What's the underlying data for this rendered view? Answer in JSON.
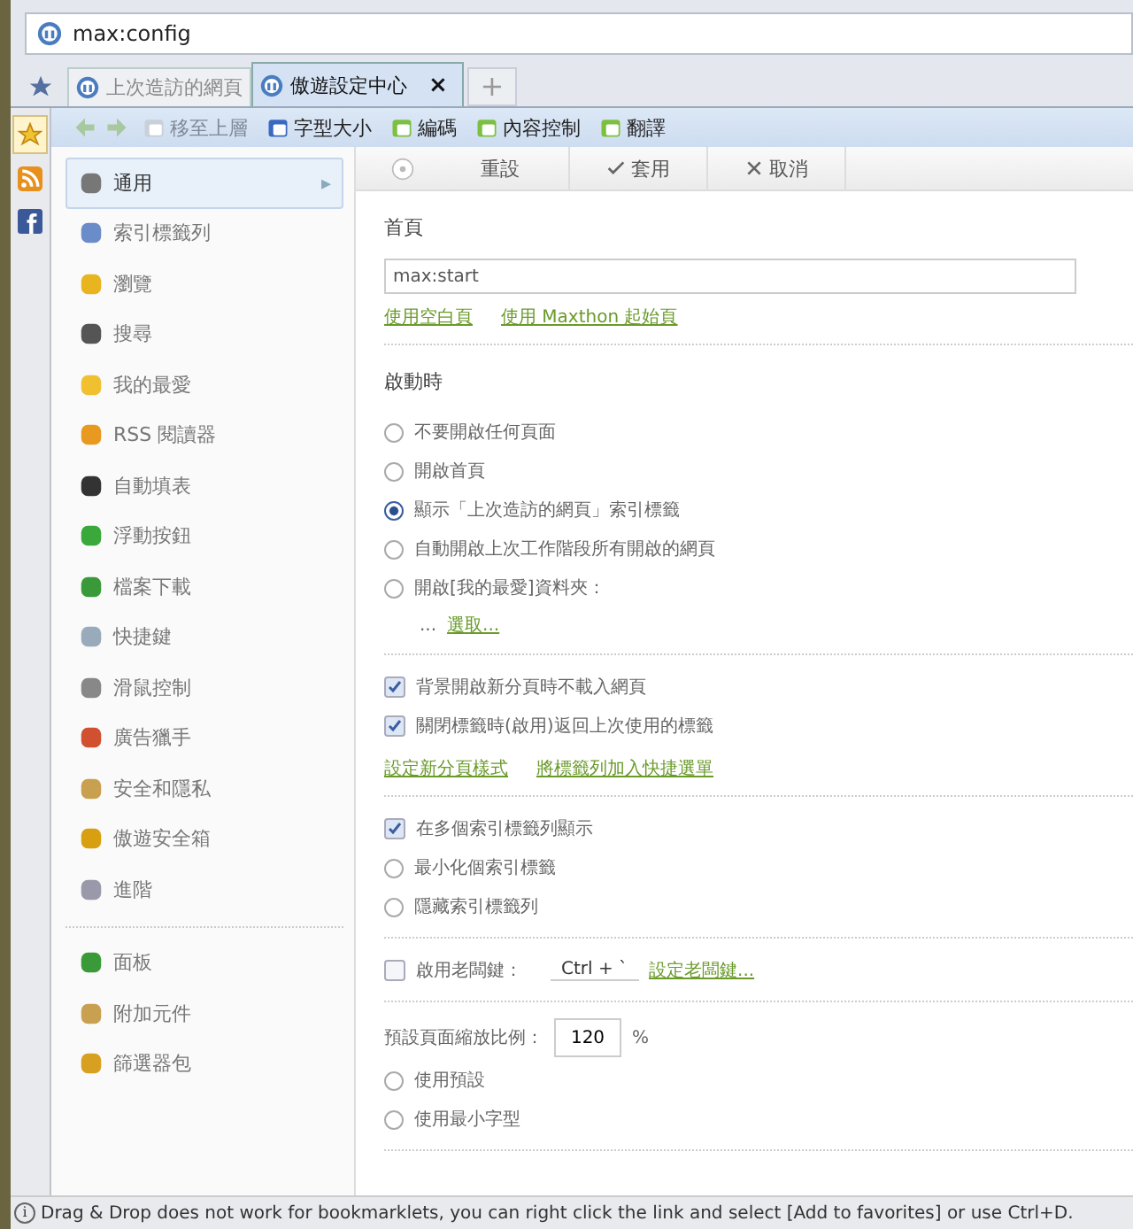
{
  "address_bar": {
    "url": "max:config"
  },
  "tabs": [
    {
      "label": "上次造訪的網頁",
      "selected": false
    },
    {
      "label": "傲遊設定中心",
      "selected": true,
      "close": "×"
    }
  ],
  "new_tab": "+",
  "toolbar": [
    {
      "label": "移至上層",
      "disabled": true
    },
    {
      "label": "字型大小",
      "disabled": false
    },
    {
      "label": "編碼",
      "disabled": false
    },
    {
      "label": "內容控制",
      "disabled": false
    },
    {
      "label": "翻譯",
      "disabled": false
    }
  ],
  "settings_nav": {
    "groups": [
      [
        {
          "label": "通用",
          "selected": true,
          "caret": "▸"
        },
        {
          "label": "索引標籤列",
          "selected": false
        },
        {
          "label": "瀏覽",
          "selected": false
        },
        {
          "label": "搜尋",
          "selected": false
        },
        {
          "label": "我的最愛",
          "selected": false
        },
        {
          "label": "RSS 閱讀器",
          "selected": false
        },
        {
          "label": "自動填表",
          "selected": false
        },
        {
          "label": "浮動按鈕",
          "selected": false
        },
        {
          "label": "檔案下載",
          "selected": false
        },
        {
          "label": "快捷鍵",
          "selected": false
        },
        {
          "label": "滑鼠控制",
          "selected": false
        },
        {
          "label": "廣告獵手",
          "selected": false
        },
        {
          "label": "安全和隱私",
          "selected": false
        },
        {
          "label": "傲遊安全箱",
          "selected": false
        },
        {
          "label": "進階",
          "selected": false
        }
      ],
      [
        {
          "label": "面板",
          "selected": false
        },
        {
          "label": "附加元件",
          "selected": false
        },
        {
          "label": "篩選器包",
          "selected": false
        }
      ]
    ]
  },
  "header_actions": [
    {
      "label": "重設"
    },
    {
      "label": "套用"
    },
    {
      "label": "取消"
    }
  ],
  "sections": [
    {
      "title": "首頁",
      "rows": [
        {
          "kind": "field",
          "value": "max:start"
        },
        {
          "kind": "links",
          "links": [
            "使用空白頁",
            "使用 Maxthon 起始頁"
          ]
        }
      ]
    },
    {
      "title": "啟動時",
      "rows": [
        {
          "kind": "radio",
          "label": "不要開啟任何頁面",
          "selected": false
        },
        {
          "kind": "radio",
          "label": "開啟首頁",
          "selected": false
        },
        {
          "kind": "radio",
          "label": "顯示「上次造訪的網頁」索引標籤",
          "selected": true
        },
        {
          "kind": "radio",
          "label": "自動開啟上次工作階段所有開啟的網頁",
          "selected": false
        },
        {
          "kind": "radio",
          "label": "開啟[我的最愛]資料夾：",
          "selected": false
        },
        {
          "kind": "path",
          "text": "...",
          "link": "選取..."
        }
      ]
    },
    {
      "rows": [
        {
          "kind": "checkbox",
          "label": "背景開啟新分頁時不載入網頁",
          "checked": true
        },
        {
          "kind": "checkbox",
          "label": "關閉標籤時(啟用)返回上次使用的標籤",
          "checked": true
        },
        {
          "kind": "links",
          "links": [
            "設定新分頁樣式",
            "將標籤列加入快捷選單"
          ]
        }
      ]
    },
    {
      "rows": [
        {
          "kind": "checkbox",
          "label": "在多個索引標籤列顯示",
          "checked": true
        },
        {
          "kind": "radio",
          "label": "最小化個索引標籤",
          "selected": false
        },
        {
          "kind": "radio",
          "label": "隱藏索引標籤列",
          "selected": false
        }
      ]
    },
    {
      "rows": [
        {
          "kind": "hotkey",
          "label": "啟用老闆鍵：",
          "checked": false,
          "key": "Ctrl + `",
          "link": "設定老闆鍵..."
        }
      ]
    },
    {
      "rows": [
        {
          "kind": "zoom",
          "label": "預設頁面縮放比例：",
          "value": "120",
          "unit": "%"
        },
        {
          "kind": "radio",
          "label": "使用預設",
          "selected": false
        },
        {
          "kind": "radio",
          "label": "使用最小字型",
          "selected": false
        }
      ]
    }
  ],
  "status_bar": {
    "icon": "i",
    "text": "Drag & Drop does not work for bookmarklets, you can right click the link and select [Add to favorites] or use Ctrl+D."
  }
}
